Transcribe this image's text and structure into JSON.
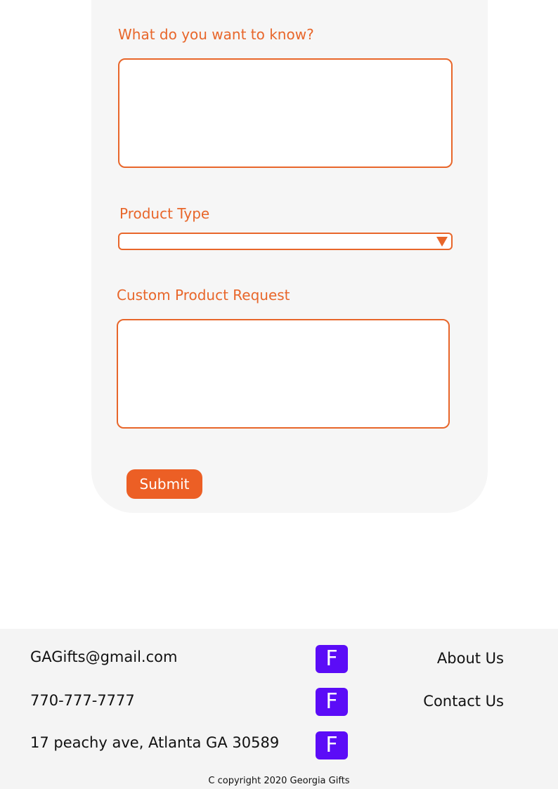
{
  "form": {
    "question_label": "What do you want to know?",
    "question_value": "",
    "product_type_label": "Product Type",
    "product_type_selected": "",
    "custom_request_label": "Custom Product Request",
    "custom_request_value": "",
    "submit_label": "Submit"
  },
  "footer": {
    "email": "GAGifts@gmail.com",
    "phone": "770-777-7777",
    "address": "17 peachy ave, Atlanta GA 30589",
    "social_icons": [
      {
        "icon": "facebook-icon",
        "glyph": "F"
      },
      {
        "icon": "facebook-icon",
        "glyph": "F"
      },
      {
        "icon": "facebook-icon",
        "glyph": "F"
      }
    ],
    "links": [
      "About Us",
      "Contact Us"
    ],
    "copyright": "C copyright 2020 Georgia Gifts"
  },
  "colors": {
    "accent": "#e8662a",
    "submit_bg": "#ec5f25",
    "icon_bg": "#5b0cf7",
    "card_bg": "#f6f6f6",
    "footer_bg": "#f4f4f4"
  }
}
